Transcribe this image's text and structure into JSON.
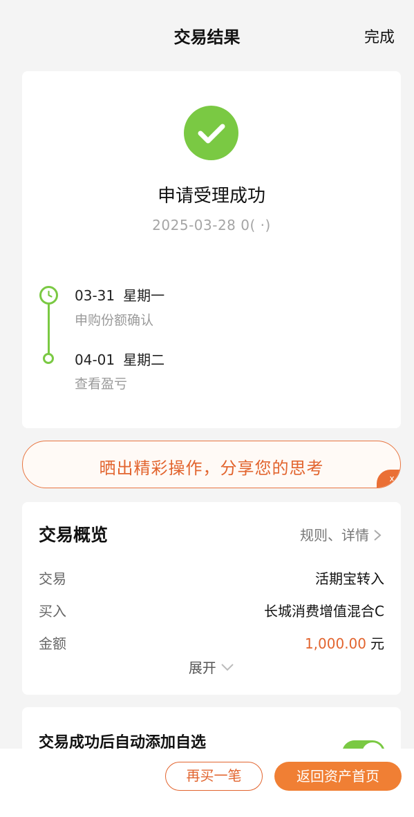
{
  "nav": {
    "title": "交易结果",
    "done_label": "完成"
  },
  "result": {
    "icon": "check-icon",
    "title": "申请受理成功",
    "time": "2025-03-28 0(  ·)"
  },
  "timeline": [
    {
      "date": "03-31",
      "weekday": "星期一",
      "desc": "申购份额确认",
      "icon": "clock-icon"
    },
    {
      "date": "04-01",
      "weekday": "星期二",
      "desc": "查看盈亏",
      "icon": "dot-icon"
    }
  ],
  "share_banner": {
    "text": "晒出精彩操作，分享您的思考",
    "close_label": "x"
  },
  "overview": {
    "title": "交易概览",
    "link_label": "规则、详情",
    "rows": [
      {
        "label": "交易",
        "value": "活期宝转入"
      },
      {
        "label": "买入",
        "value": "长城消费增值混合C"
      },
      {
        "label": "金额",
        "amount": "1,000.00",
        "unit": "元"
      }
    ],
    "expand_label": "展开"
  },
  "auto_add": {
    "title": "交易成功后自动添加自选",
    "toggle_on": true
  },
  "bottom": {
    "buy_again_label": "再买一笔",
    "home_label": "返回资产首页"
  },
  "colors": {
    "success_green": "#7ac943",
    "accent_orange": "#e2642e",
    "button_orange": "#f07f34"
  }
}
